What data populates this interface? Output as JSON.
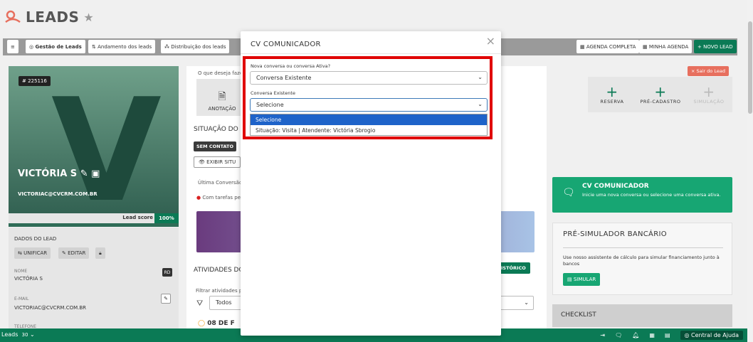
{
  "page": {
    "title": "LEADS"
  },
  "toolbar": {
    "menu_icon": "≡",
    "tabs": [
      {
        "label": "Gestão de Leads"
      },
      {
        "label": "Andamento dos leads"
      },
      {
        "label": "Distribuição dos leads"
      }
    ],
    "agenda_completa": "AGENDA COMPLETA",
    "minha_agenda": "MINHA AGENDA",
    "novo_lead": "+ NOVO LEAD"
  },
  "lead": {
    "id": "# 225116",
    "initial": "V",
    "name": "VICTÓRIA S",
    "email": "VICTORIAC@CVCRM.COM.BR",
    "lead_score_label": "Lead score",
    "lead_score_value": "100%",
    "dados_label": "DADOS DO LEAD",
    "unificar": "UNIFICAR",
    "editar": "EDITAR",
    "nome_label": "NOME",
    "nome_value": "VICTÓRIA S",
    "rd_badge": "RD",
    "email_label": "E-MAIL",
    "email_value": "VICTORIAC@CVCRM.COM.BR",
    "telefone_label": "TELEFONE"
  },
  "middle": {
    "ask": "O que deseja fazer",
    "anotacao": "ANOTAÇÃO",
    "situacao": "SITUAÇÃO DO L",
    "sem_contato": "SEM CONTATO",
    "exibir": "EXIBIR SITU",
    "ultima": "Última Conversão",
    "tarefas": "Com tarefas pe",
    "atividades": "ATIVIDADES DO",
    "historico": "ISTÓRICO",
    "filtrar": "Filtrar atividades p",
    "todos": "Todos",
    "date": "08 DE F"
  },
  "right": {
    "sair": "× Sair do Lead",
    "reserva": "RESERVA",
    "pre_cadastro": "PRÉ-CADASTRO",
    "simulacao": "SIMULAÇÃO",
    "cv_title": "CV COMUNICADOR",
    "cv_sub": "Inicie uma nova conversa ou selecione uma conversa ativa.",
    "sim_title": "PRÉ-SIMULADOR BANCÁRIO",
    "sim_sub": "Use nosso assistente de cálculo para simular financiamento junto à bancos",
    "sim_btn": "SIMULAR",
    "checklist": "CHECKLIST"
  },
  "status_bar": {
    "left": "Leads",
    "count": "30",
    "help": "Central de Ajuda"
  },
  "modal": {
    "title": "CV COMUNICADOR",
    "field1_label": "Nova conversa ou conversa Ativa?",
    "field1_value": "Conversa Existente",
    "field2_label": "Conversa Existente",
    "field2_value": "Selecione",
    "options": [
      {
        "label": "Selecione"
      },
      {
        "label": "Situação: Visita | Atendente: Victória Sbrogio"
      }
    ]
  },
  "colors": {
    "brand_green": "#0b7a55",
    "highlight": "#e00000",
    "option_selected": "#1e63c9"
  }
}
